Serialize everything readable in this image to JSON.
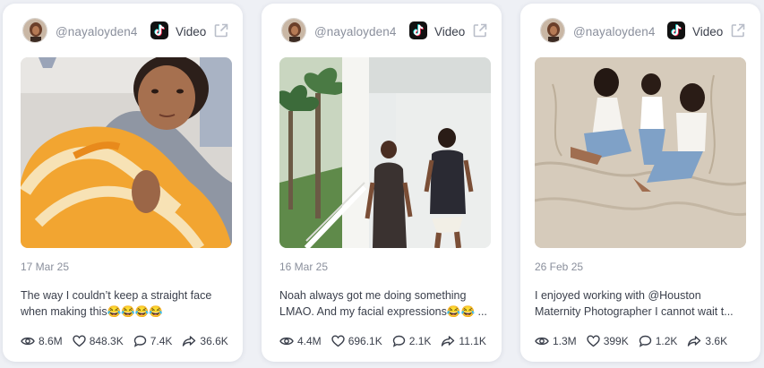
{
  "cards": [
    {
      "handle": "@nayaloyden4",
      "platform_label": "Video",
      "platform_icon": "tiktok-icon",
      "date": "17 Mar 25",
      "caption_line1": "The way I couldn’t keep a straight face",
      "caption_line2": "when making this😂😂😂😂",
      "views": "8.6M",
      "likes": "848.3K",
      "comments": "7.4K",
      "shares": "36.6K"
    },
    {
      "handle": "@nayaloyden4",
      "platform_label": "Video",
      "platform_icon": "tiktok-icon",
      "date": "16 Mar 25",
      "caption_line1": "Noah always got me doing something",
      "caption_line2": "LMAO. And my facial expressions😂😂 ...",
      "views": "4.4M",
      "likes": "696.1K",
      "comments": "2.1K",
      "shares": "11.1K"
    },
    {
      "handle": "@nayaloyden4",
      "platform_label": "Video",
      "platform_icon": "tiktok-icon",
      "date": "26 Feb 25",
      "caption_line1": "I enjoyed working with @Houston",
      "caption_line2": "Maternity Photographer I cannot wait t...",
      "views": "1.3M",
      "likes": "399K",
      "comments": "1.2K",
      "shares": "3.6K"
    }
  ],
  "colors": {
    "card_bg": "#ffffff",
    "page_bg": "#eef0f5",
    "muted_text": "#8a8f9c",
    "body_text": "#3a3f4b",
    "tiktok_cyan": "#25f4ee",
    "tiktok_pink": "#fe2c55"
  }
}
